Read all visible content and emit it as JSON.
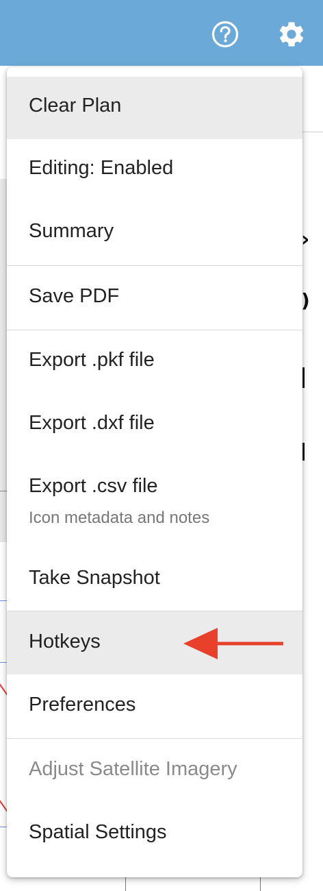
{
  "menu": {
    "items": [
      {
        "label": "Clear Plan"
      },
      {
        "label": "Editing: Enabled"
      },
      {
        "label": "Summary"
      },
      {
        "label": "Save PDF"
      },
      {
        "label": "Export .pkf file"
      },
      {
        "label": "Export .dxf file"
      },
      {
        "label": "Export .csv file",
        "sublabel": "Icon metadata and notes"
      },
      {
        "label": "Take Snapshot"
      },
      {
        "label": "Hotkeys"
      },
      {
        "label": "Preferences"
      },
      {
        "label": "Adjust Satellite Imagery"
      },
      {
        "label": "Spatial Settings"
      }
    ],
    "highlighted": [
      "Clear Plan",
      "Hotkeys"
    ],
    "disabled": [
      "Adjust Satellite Imagery"
    ]
  },
  "toolbar": {
    "icons": [
      "help-circle-icon",
      "gear-icon"
    ]
  },
  "annotation": {
    "icon": "red-arrow-icon",
    "color": "#e8402a",
    "points_to": "Hotkeys"
  },
  "colors": {
    "topbar": "#6aa9d8",
    "highlight": "#ebebeb",
    "disabled_text": "#8a8a8a"
  }
}
